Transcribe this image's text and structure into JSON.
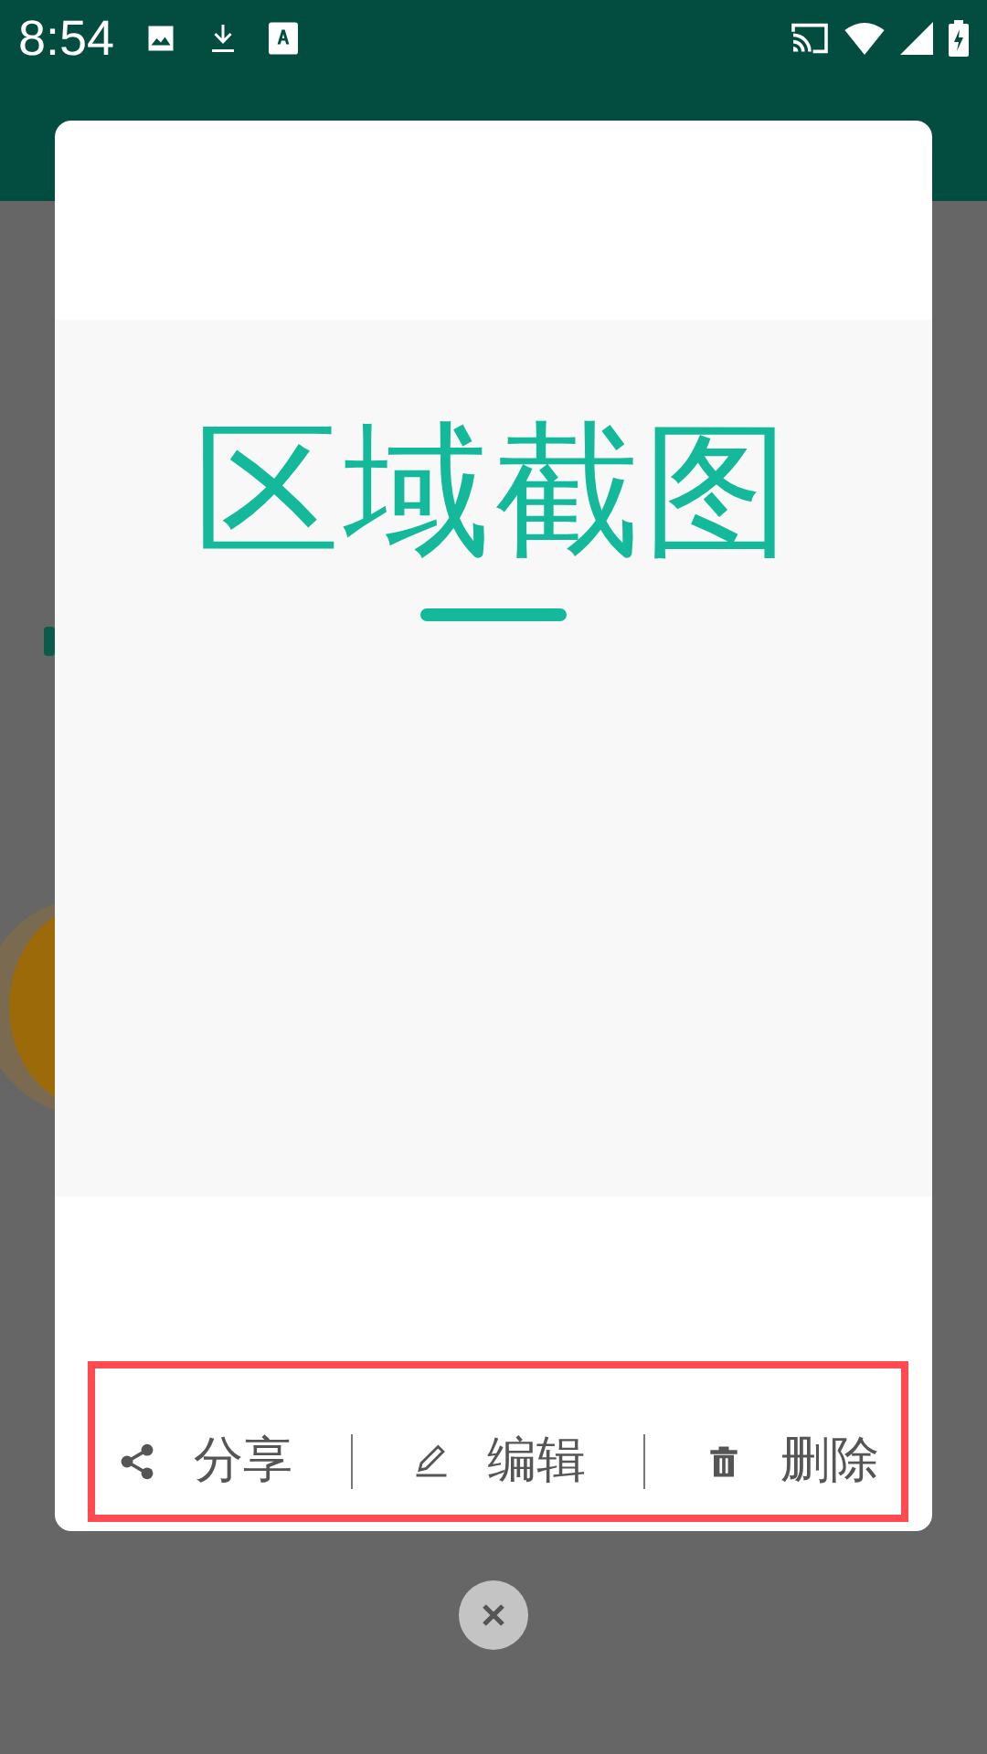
{
  "status_bar": {
    "time": "8:54"
  },
  "dialog": {
    "preview": {
      "title": "区域截图"
    },
    "actions_highlighted": true,
    "actions": [
      {
        "kind": "share",
        "label": "分享"
      },
      {
        "kind": "edit",
        "label": "编辑"
      },
      {
        "kind": "delete",
        "label": "删除"
      }
    ]
  }
}
